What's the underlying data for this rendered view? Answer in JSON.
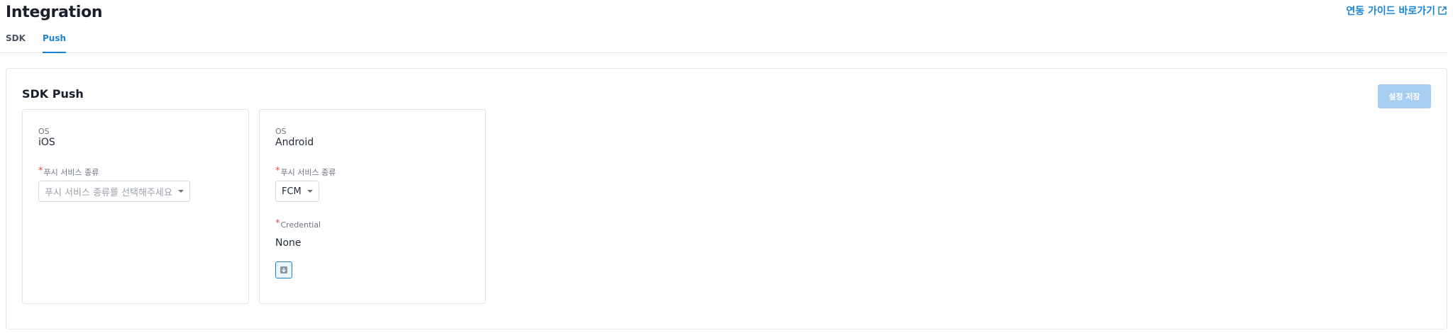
{
  "header": {
    "title": "Integration",
    "guide_link": "연동 가이드 바로가기"
  },
  "tabs": [
    {
      "label": "SDK",
      "active": false
    },
    {
      "label": "Push",
      "active": true
    }
  ],
  "panel": {
    "title": "SDK Push",
    "save_label": "설정 저장",
    "save_enabled": false
  },
  "cards": {
    "ios": {
      "os_label": "OS",
      "os_value": "iOS",
      "push_type_label": "푸시 서비스 종류",
      "push_type_placeholder": "푸시 서비스 종류를 선택해주세요"
    },
    "android": {
      "os_label": "OS",
      "os_value": "Android",
      "push_type_label": "푸시 서비스 종류",
      "push_type_value": "FCM",
      "credential_label": "Credential",
      "credential_value": "None"
    }
  },
  "colors": {
    "accent": "#1a85d6",
    "required": "#e5484d",
    "save_disabled": "#a7cdf0"
  },
  "icons": [
    "external-link-icon",
    "chevron-down-icon",
    "upload-icon"
  ]
}
